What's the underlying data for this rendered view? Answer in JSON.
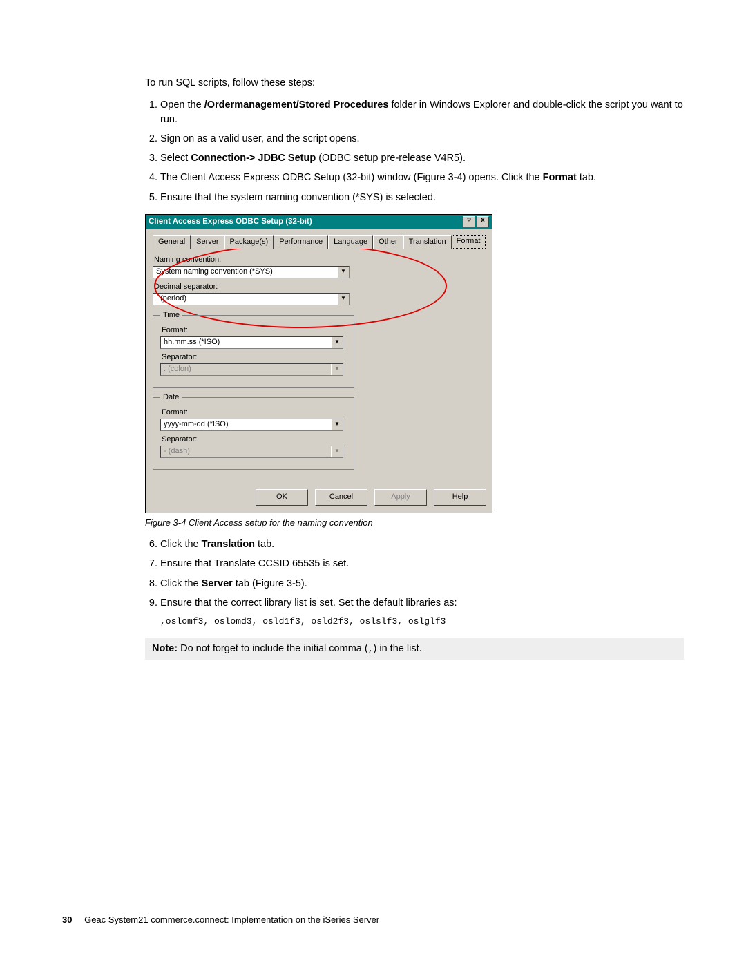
{
  "intro": "To run SQL scripts, follow these steps:",
  "steps": {
    "s1a": "Open the ",
    "s1b": "/Ordermanagement/Stored Procedures",
    "s1c": " folder in Windows Explorer and double-click the script you want to run.",
    "s2": "Sign on as a valid user, and the script opens.",
    "s3a": "Select ",
    "s3b": "Connection-> JDBC Setup",
    "s3c": " (ODBC setup pre-release V4R5).",
    "s4a": "The Client Access Express ODBC Setup (32-bit) window (Figure 3-4) opens. Click the ",
    "s4b": "Format",
    "s4c": " tab.",
    "s5": "Ensure that the system naming convention (*SYS) is selected.",
    "s6a": "Click the ",
    "s6b": "Translation",
    "s6c": " tab.",
    "s7": "Ensure that Translate CCSID 65535 is set.",
    "s8a": "Click the ",
    "s8b": "Server",
    "s8c": " tab (Figure 3-5).",
    "s9": "Ensure that the correct library list is set. Set the default libraries as:",
    "s9code": ",oslomf3, oslomd3, osld1f3, osld2f3, oslslf3, oslglf3"
  },
  "dialog": {
    "title": "Client Access Express ODBC Setup (32-bit)",
    "help_btn": "?",
    "close_btn": "X",
    "tabs": [
      "General",
      "Server",
      "Package(s)",
      "Performance",
      "Language",
      "Other",
      "Translation",
      "Format"
    ],
    "naming_label": "Naming convention:",
    "naming_value": "System naming convention  (*SYS)",
    "decsep_label": "Decimal separator:",
    "decsep_value": ".  (period)",
    "time_legend": "Time",
    "time_format_label": "Format:",
    "time_format_value": "hh.mm.ss  (*ISO)",
    "time_sep_label": "Separator:",
    "time_sep_value": ":  (colon)",
    "date_legend": "Date",
    "date_format_label": "Format:",
    "date_format_value": "yyyy-mm-dd  (*ISO)",
    "date_sep_label": "Separator:",
    "date_sep_value": "-  (dash)",
    "btn_ok": "OK",
    "btn_cancel": "Cancel",
    "btn_apply": "Apply",
    "btn_help": "Help"
  },
  "figcaption": "Figure 3-4   Client Access setup for the naming convention",
  "note": {
    "bold": "Note:",
    "text_a": " Do not forget to include the initial comma (",
    "code": ",",
    "text_b": ") in the list."
  },
  "footer": {
    "page": "30",
    "title": "Geac System21 commerce.connect: Implementation on the iSeries Server"
  }
}
